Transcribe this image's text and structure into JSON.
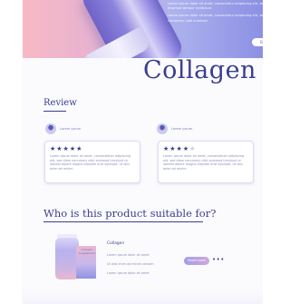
{
  "hero": {
    "paragraph_1": "Lorem ipsum dolor sit amet, consectetur adipiscing elit, sed do eiusmod tempor incididunt",
    "paragraph_2": "Lorem ipsum dolor sit amet, consectetur adipiscing elit, sed diam nonummy nibh euismod",
    "buy_label": "Buy"
  },
  "brand": {
    "title": "Collagen"
  },
  "review": {
    "title": "Review",
    "reviews": [
      {
        "name": "Lorem ipsum",
        "rating": 5,
        "stars_on": "★★★★★",
        "stars_off": "",
        "text": "Lorem ipsum dolor sit amet, consectetuer adipiscing elit, sed diam nonummy nibh euismod tincidunt ut laoreet dolore magna aliquam erat volutpat. Ut wisi enim ad minim"
      },
      {
        "name": "Lorem ipsum",
        "rating": 4,
        "stars_on": "★★★★",
        "stars_off": "★",
        "text": "Lorem ipsum dolor sit amet, consectetuer adipiscing elit, sed diam nonummy nibh euismod tincidunt ut laoreet dolore magna aliquam erat volutpat. Ut wisi enim ad minim"
      }
    ]
  },
  "suitable": {
    "title": "Who is this product suitable for?",
    "product_name": "Collagen",
    "box_label": "Collagen Supplement",
    "bullets": [
      "Lorem ipsum dolor sit amet",
      "Ut wisi enim ad minim veniam",
      "Lorem ipsum dolor sit amet"
    ],
    "button_label": "Read more",
    "more_glyph": "•••"
  },
  "colors": {
    "accent": "#3b3e8f",
    "gradient_pink": "#f7b9c4",
    "gradient_violet": "#8c90e4"
  }
}
